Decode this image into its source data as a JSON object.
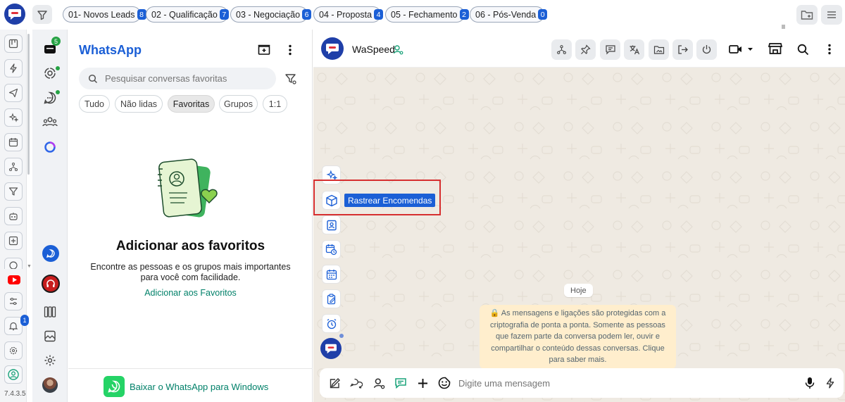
{
  "top": {
    "stages": [
      {
        "label": "01- Novos Leads",
        "count": "8"
      },
      {
        "label": "02 - Qualificação",
        "count": "7"
      },
      {
        "label": "03 - Negociação",
        "count": "6"
      },
      {
        "label": "04 - Proposta",
        "count": "4"
      },
      {
        "label": "05 - Fechamento",
        "count": "2"
      },
      {
        "label": "06 - Pós-Venda",
        "count": "0"
      }
    ]
  },
  "rail": {
    "version": "7.4.3.5",
    "notifications_badge": "1",
    "chats_badge": "5"
  },
  "panel": {
    "title": "WhatsApp",
    "search_placeholder": "Pesquisar conversas favoritas",
    "filters": [
      "Tudo",
      "Não lidas",
      "Favoritas",
      "Grupos",
      "1:1"
    ],
    "active_filter": "Favoritas",
    "empty_title": "Adicionar aos favoritos",
    "empty_desc_1": "Encontre as pessoas e os grupos mais importantes",
    "empty_desc_2": "para você com facilidade.",
    "empty_link": "Adicionar aos Favoritos",
    "download_label": "Baixar o WhatsApp para Windows"
  },
  "chat": {
    "contact_name": "WaSpeed",
    "tooltip": "Rastrear Encomendas",
    "date_chip": "Hoje",
    "encryption_notice": "🔒 As mensagens e ligações são protegidas com a criptografia de ponta a ponta. Somente as pessoas que fazem parte da conversa podem ler, ouvir e compartilhar o conteúdo dessas conversas. Clique para saber mais.",
    "composer_placeholder": "Digite uma mensagem"
  },
  "colors": {
    "accent": "#1b5fd6",
    "whatsapp_green": "#008069",
    "highlight": "#d62f2f",
    "chat_bg": "#efeae2"
  }
}
